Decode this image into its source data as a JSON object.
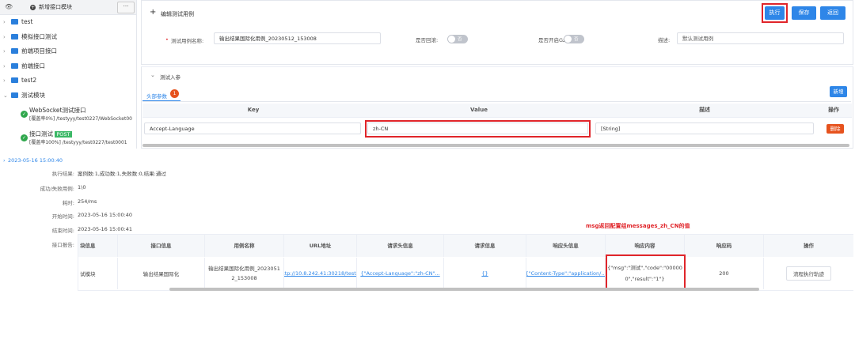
{
  "sidebar": {
    "add_module_label": "新增接口模块",
    "more_label": "···",
    "folders": [
      {
        "label": "test",
        "arrow": "›"
      },
      {
        "label": "模拟接口测试",
        "arrow": "›"
      },
      {
        "label": "前端项目接口",
        "arrow": "›"
      },
      {
        "label": "前端接口",
        "arrow": "›"
      },
      {
        "label": "test2",
        "arrow": "›"
      },
      {
        "label": "测试模块",
        "arrow": "⌄"
      }
    ],
    "apis": [
      {
        "name": "WebSocket测试接口",
        "coverage": "[覆盖率0%]",
        "path": "/testyyy/test0227/WebSocket00"
      },
      {
        "name": "接口测试",
        "method": "POST",
        "coverage": "[覆盖率100%]",
        "path": "/testyyy/test0227/test0001"
      }
    ]
  },
  "header": {
    "plus": "+",
    "title": "编辑测试用例",
    "execute_label": "执行",
    "save_label": "保存",
    "back_label": "返回"
  },
  "form": {
    "required_mark": "•",
    "case_name_label": "测试用例名称:",
    "case_name_value": "输出结果国际化用例_20230512_153008",
    "rollback_label": "是否回滚:",
    "rollback_value": "否",
    "gzip_label": "是否开启Gzip",
    "gzip_value": "否",
    "desc_label": "描述:",
    "desc_placeholder": "默认测试用例"
  },
  "params": {
    "section_arrow": "⌄",
    "section_title": "测试入参",
    "tab_label": "头部参数",
    "tab_badge": "1",
    "add_label": "新增",
    "columns": [
      "Key",
      "Value",
      "描述",
      "操作"
    ],
    "row": {
      "key": "Accept-Language",
      "value": "zh-CN",
      "desc": "[String]",
      "delete_label": "删除"
    }
  },
  "result": {
    "timestamp": "2023-05-16 15:00:40",
    "timestamp_arrow": "›",
    "fields": [
      {
        "label": "执行结果:",
        "value": "案例数:1,成功数:1,失败数:0,结果:通过"
      },
      {
        "label": "成功/失败用例:",
        "value": "1\\0"
      },
      {
        "label": "耗时:",
        "value": "254/ms"
      },
      {
        "label": "开始时间:",
        "value": "2023-05-16 15:00:40"
      },
      {
        "label": "结束时间:",
        "value": "2023-05-16 15:00:41"
      }
    ],
    "report_label": "接口报告:",
    "annotation": "msg返回配置组messages_zh_CN的值",
    "table_columns": [
      "块信息",
      "接口信息",
      "用例名称",
      "URL地址",
      "请求头信息",
      "请求信息",
      "响应头信息",
      "响应内容",
      "响应码",
      "操作"
    ],
    "table_row": {
      "block": "试模块",
      "api": "输出结果国际化",
      "case_line1": "输出结果国际化用例_2023051",
      "case_line2": "2_153008",
      "url": "http://10.8.242.41:30218/test...",
      "req_headers": "{\"Accept-Language\":\"zh-CN\"...",
      "req_info": "{}",
      "resp_headers": "{\"Content-Type\":\"application/...",
      "resp_line1": "{\"msg\":\"测试\",\"code\":\"00000",
      "resp_line2": "0\",\"result\":\"1\"}",
      "status": "200",
      "flow_button": "流程执行轨迹"
    }
  },
  "colors": {
    "accent": "#2e86e8",
    "highlight": "#e0252a",
    "success": "#2fa74c",
    "danger": "#e6521d"
  }
}
